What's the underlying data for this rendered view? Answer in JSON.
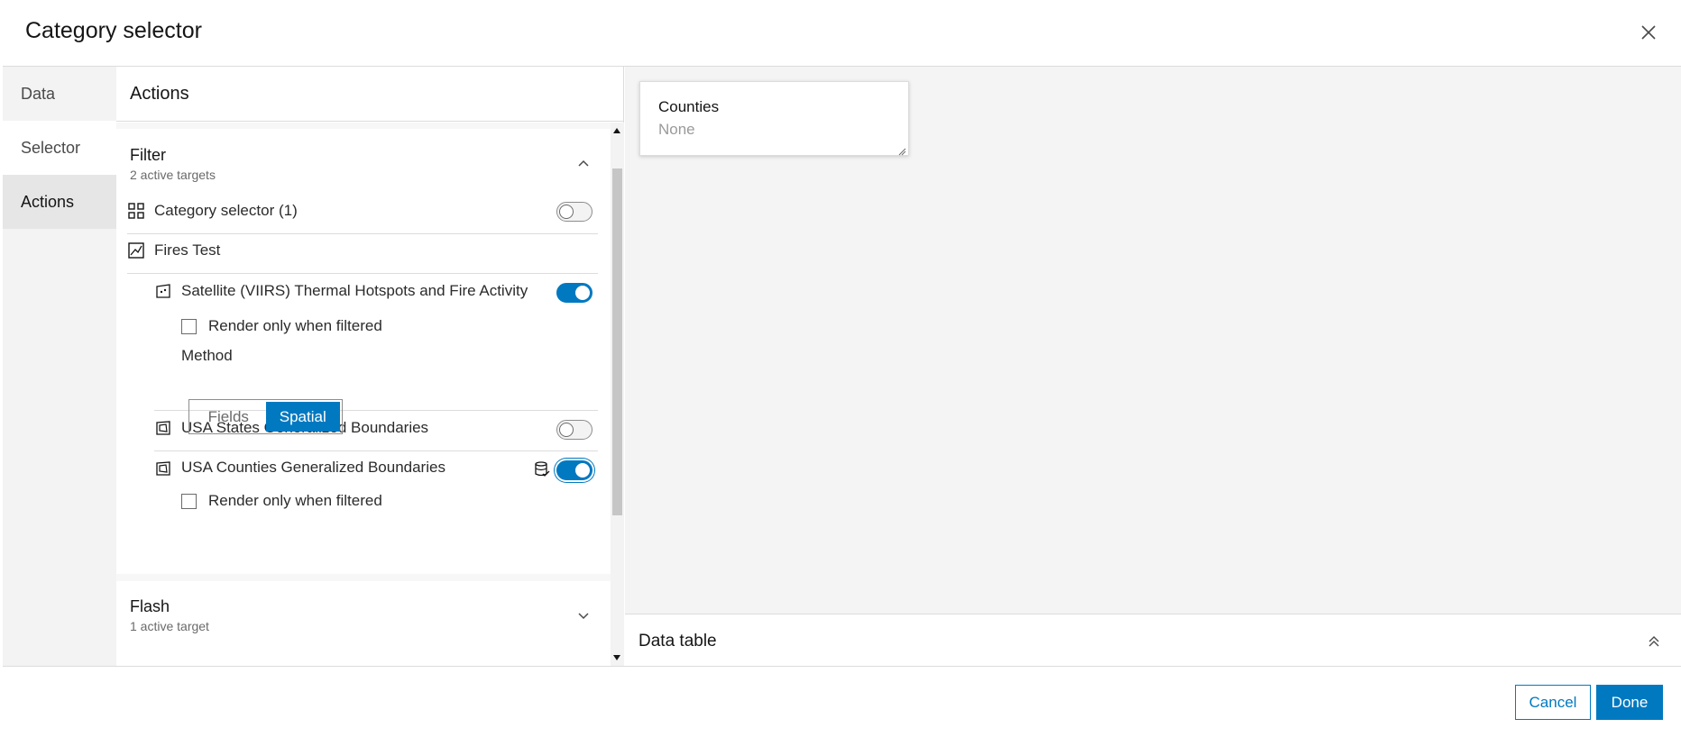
{
  "dialog": {
    "title": "Category selector",
    "close_icon": "close-icon"
  },
  "nav": {
    "items": [
      {
        "label": "Data"
      },
      {
        "label": "Selector"
      },
      {
        "label": "Actions"
      }
    ],
    "current": "Actions"
  },
  "panel": {
    "title": "Actions",
    "filter": {
      "title": "Filter",
      "subtitle": "2 active targets",
      "expanded": true,
      "targets": [
        {
          "label": "Category selector (1)",
          "icon": "category-selector-icon",
          "enabled": false
        },
        {
          "label": "Fires Test",
          "icon": "map-icon"
        },
        {
          "label": "Satellite (VIIRS) Thermal Hotspots and Fire Activity",
          "icon": "point-layer-icon",
          "enabled": true
        },
        {
          "label": "USA States Generalized Boundaries",
          "icon": "polygon-layer-icon",
          "enabled": false
        },
        {
          "label": "USA Counties Generalized Boundaries",
          "icon": "polygon-layer-icon",
          "enabled": true
        }
      ],
      "render_only_label": "Render only when filtered",
      "method_label": "Method",
      "method_options": [
        "Fields",
        "Spatial"
      ],
      "method_selected": "Spatial"
    },
    "flash": {
      "title": "Flash",
      "subtitle": "1 active target",
      "expanded": false
    }
  },
  "canvas": {
    "card_title": "Counties",
    "card_value": "None"
  },
  "datatable": {
    "label": "Data table"
  },
  "footer": {
    "cancel_label": "Cancel",
    "done_label": "Done"
  },
  "colors": {
    "accent": "#0079c1",
    "nav_current_bg": "#e6e6e6"
  }
}
